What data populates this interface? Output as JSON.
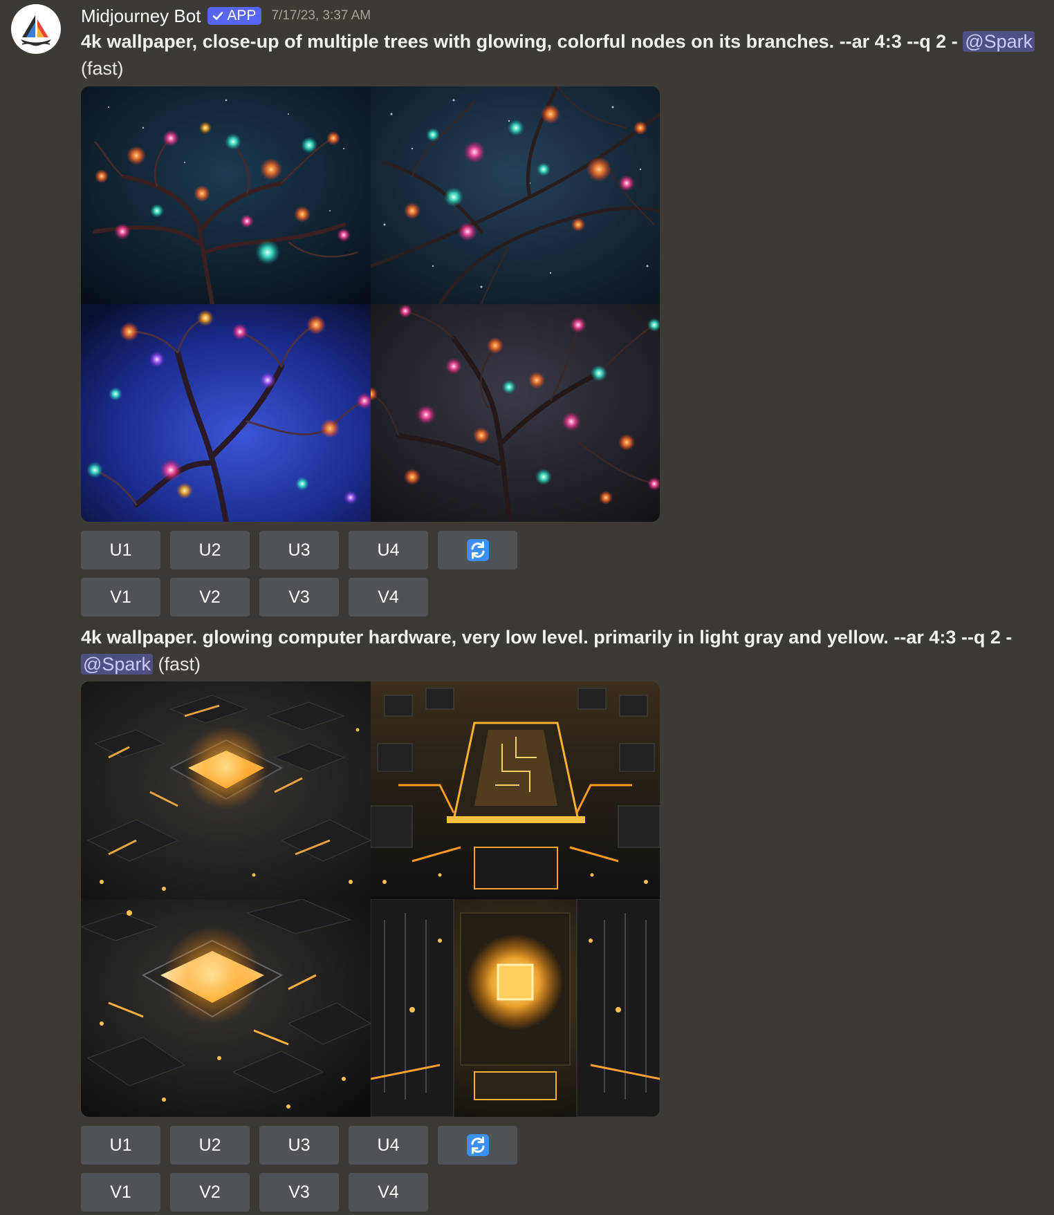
{
  "message": {
    "avatar_icon": "midjourney-sailboat-logo",
    "username": "Midjourney Bot",
    "badge_label": "APP",
    "timestamp": "7/17/23, 3:37 AM"
  },
  "jobs": [
    {
      "prompt_line1": "4k wallpaper, close-up of multiple trees with glowing, colorful nodes on its branches. --ar 4:3 --q 2 - ",
      "mention": "@Spark",
      "speed": "(fast)",
      "image_theme": "glowing-trees",
      "upscale_buttons": [
        "U1",
        "U2",
        "U3",
        "U4"
      ],
      "reroll_icon": "refresh-icon",
      "variation_buttons": [
        "V1",
        "V2",
        "V3",
        "V4"
      ]
    },
    {
      "prompt_line1": "4k wallpaper. glowing computer hardware, very low level. primarily in light gray and yellow. --ar 4:3 --q 2 -",
      "mention": "@Spark",
      "speed": "(fast)",
      "image_theme": "glowing-hardware",
      "upscale_buttons": [
        "U1",
        "U2",
        "U3",
        "U4"
      ],
      "reroll_icon": "refresh-icon",
      "variation_buttons": [
        "V1",
        "V2",
        "V3",
        "V4"
      ]
    }
  ],
  "colors": {
    "background": "#3d3a35",
    "button": "#4f5257",
    "badge": "#5865f2",
    "mention_bg": "#4e4f83",
    "reroll_icon": "#3c8ff5"
  }
}
